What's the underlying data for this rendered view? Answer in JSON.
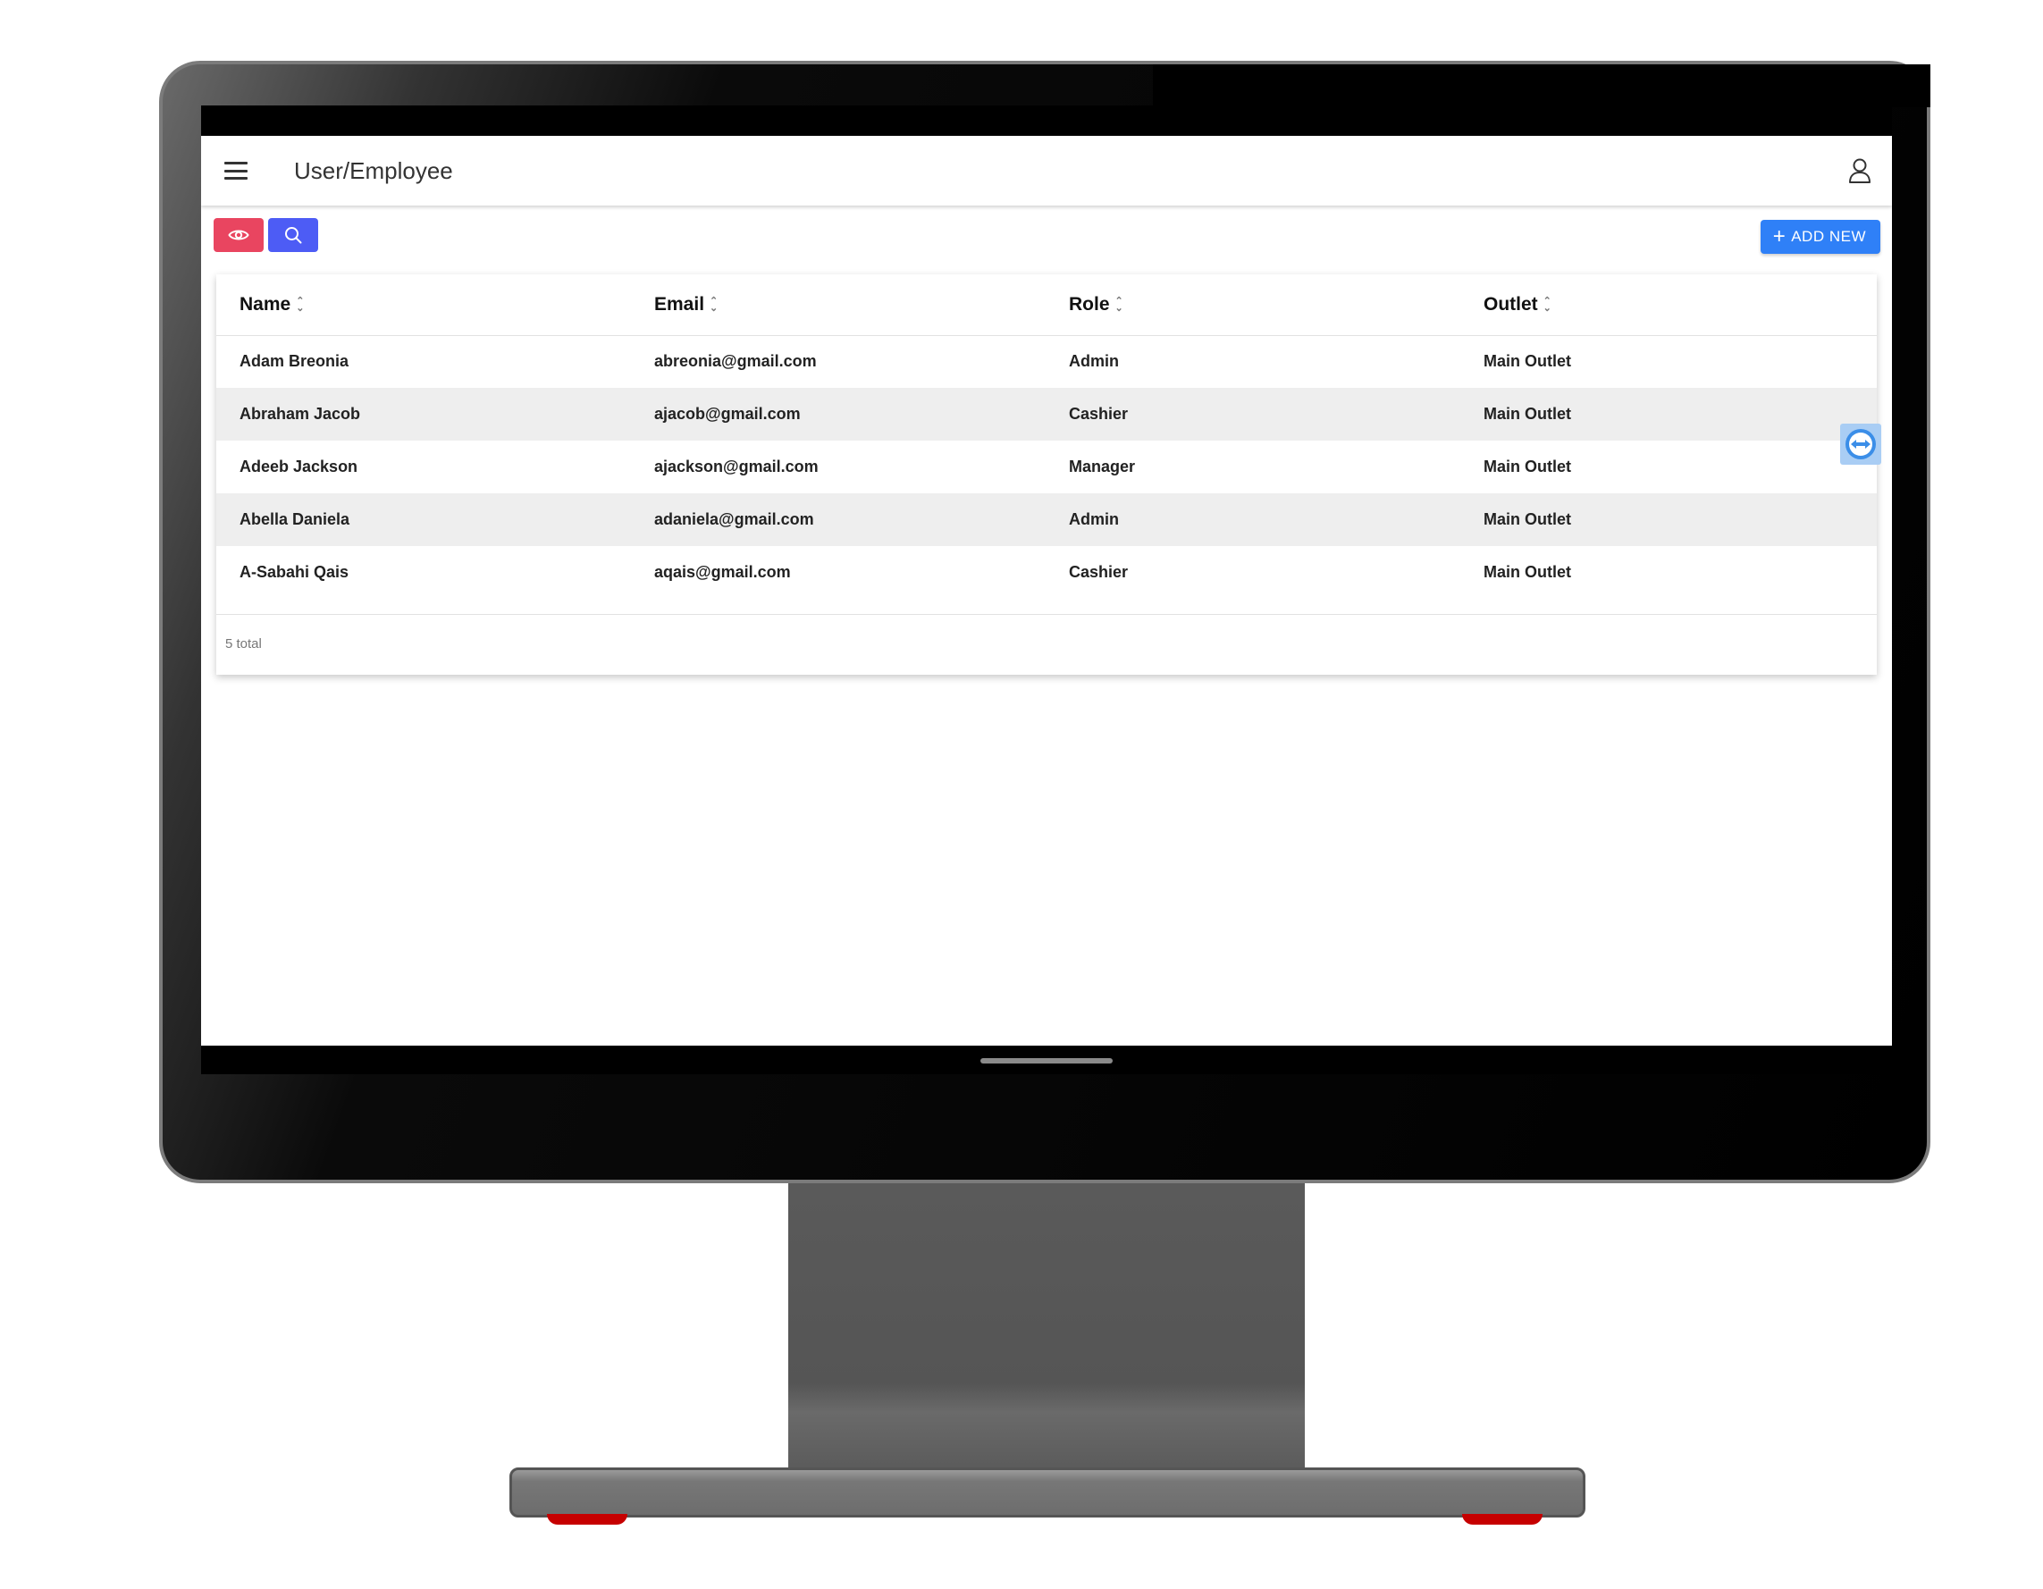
{
  "app": {
    "title": "User/Employee"
  },
  "toolbar": {
    "view_icon": "eye-icon",
    "search_icon": "search-icon",
    "add_label": "ADD NEW",
    "add_icon": "plus-icon"
  },
  "table": {
    "columns": [
      "Name",
      "Email",
      "Role",
      "Outlet"
    ],
    "rows": [
      [
        "Adam Breonia",
        "abreonia@gmail.com",
        "Admin",
        "Main Outlet"
      ],
      [
        "Abraham Jacob",
        "ajacob@gmail.com",
        "Cashier",
        "Main Outlet"
      ],
      [
        "Adeeb Jackson",
        "ajackson@gmail.com",
        "Manager",
        "Main Outlet"
      ],
      [
        "Abella Daniela",
        "adaniela@gmail.com",
        "Admin",
        "Main Outlet"
      ],
      [
        "A-Sabahi Qais",
        "aqais@gmail.com",
        "Cashier",
        "Main Outlet"
      ]
    ],
    "footer": "5 total"
  },
  "colors": {
    "view_button": "#e94560",
    "search_button": "#4d5cf5",
    "add_button": "#2f80f7",
    "row_alt": "#eeeeee"
  }
}
